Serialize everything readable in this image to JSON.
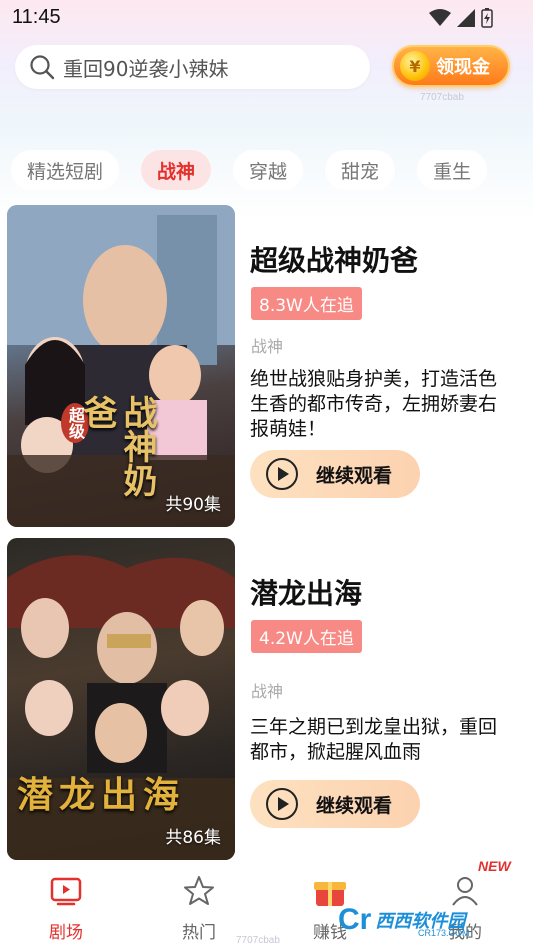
{
  "status": {
    "time": "11:45"
  },
  "search": {
    "text": "重回90逆袭小辣妹"
  },
  "cash_button": {
    "label": "领现金",
    "coin_symbol": "¥"
  },
  "watermark_top": "7707cbab",
  "tabs": [
    {
      "label": "精选短剧",
      "active": false
    },
    {
      "label": "战神",
      "active": true
    },
    {
      "label": "穿越",
      "active": false
    },
    {
      "label": "甜宠",
      "active": false
    },
    {
      "label": "重生",
      "active": false
    }
  ],
  "dramas": [
    {
      "title": "超级战神奶爸",
      "followers": "8.3W人在追",
      "genre": "战神",
      "description": "绝世战狼贴身护美，打造活色生香的都市传奇，左拥娇妻右报萌娃！",
      "episodes": "共90集",
      "poster_calligraphy": "战神奶爸",
      "poster_tag": "超级",
      "button_label": "继续观看"
    },
    {
      "title": "潜龙出海",
      "followers": "4.2W人在追",
      "genre": "战神",
      "description": "三年之期已到龙皇出狱，重回都市，掀起腥风血雨",
      "episodes": "共86集",
      "poster_calligraphy": "潜龙出海",
      "button_label": "继续观看"
    }
  ],
  "bottom_nav": [
    {
      "label": "剧场",
      "icon": "tv-icon",
      "active": true
    },
    {
      "label": "热门",
      "icon": "star-icon",
      "active": false
    },
    {
      "label": "赚钱",
      "icon": "gift-icon",
      "active": false
    },
    {
      "label": "我的",
      "icon": "user-icon",
      "active": false
    }
  ],
  "new_badge": "NEW",
  "watermark_bottom": "7707cbab",
  "site_logo": {
    "text": "西西软件园",
    "url": "CR173.COM"
  },
  "colors": {
    "accent": "#e3312d",
    "follow_badge": "#f88a86",
    "cash_orange": "#ff7a1a"
  }
}
